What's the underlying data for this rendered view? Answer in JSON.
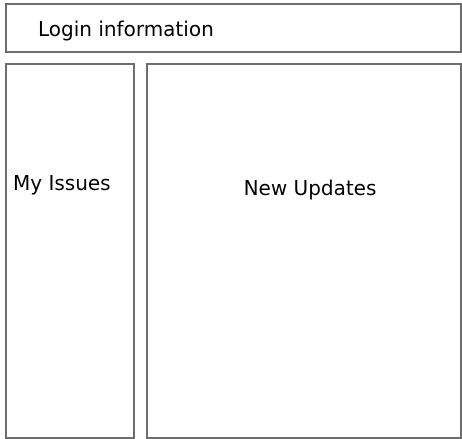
{
  "header": {
    "label": "Login information"
  },
  "sidebar": {
    "label": "My Issues"
  },
  "main": {
    "label": "New Updates"
  },
  "colors": {
    "border": "#6e6e6e",
    "background": "#ffffff",
    "text": "#000000"
  }
}
